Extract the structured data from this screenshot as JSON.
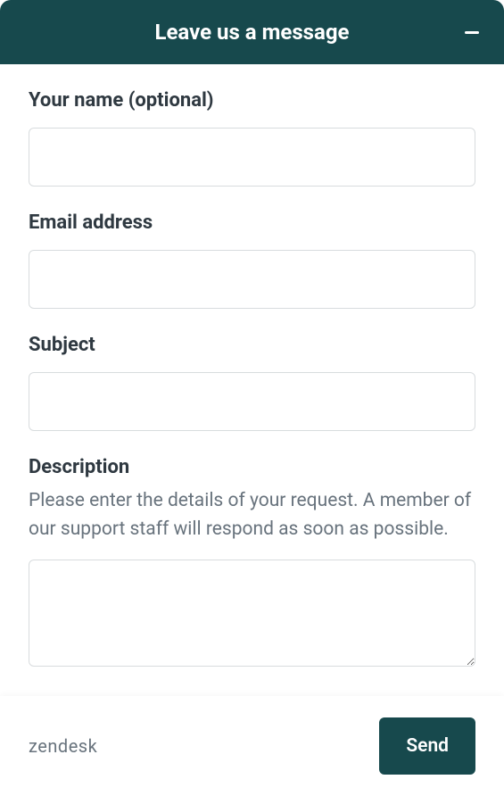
{
  "header": {
    "title": "Leave us a message"
  },
  "form": {
    "name": {
      "label": "Your name (optional)",
      "value": ""
    },
    "email": {
      "label": "Email address",
      "value": ""
    },
    "subject": {
      "label": "Subject",
      "value": ""
    },
    "description": {
      "label": "Description",
      "help": "Please enter the details of your request. A member of our support staff will respond as soon as possible.",
      "value": ""
    }
  },
  "footer": {
    "brand": "zendesk",
    "send_label": "Send"
  }
}
